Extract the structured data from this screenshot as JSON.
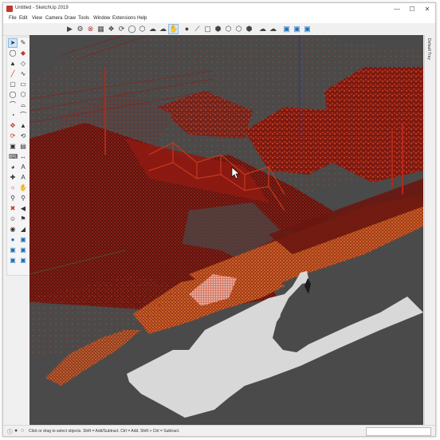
{
  "window": {
    "title": "Untitled - SketchUp 2019"
  },
  "window_controls": [
    {
      "name": "minimize-button",
      "glyph": "—"
    },
    {
      "name": "maximize-button",
      "glyph": "☐"
    },
    {
      "name": "close-button",
      "glyph": "✕"
    }
  ],
  "menu": [
    "File",
    "Edit",
    "View",
    "Camera",
    "Draw",
    "Tools",
    "Window",
    "Extensions",
    "Help"
  ],
  "toolbar": {
    "icons": [
      "select-icon",
      "gear-icon",
      "eraser-icon",
      "paint-icon",
      "components-icon",
      "orbit-icon",
      "circle-icon",
      "polygon-icon",
      "cloud-upload-icon",
      "cloud-download-icon",
      "pan-icon",
      "dot-icon",
      "line-icon",
      "box-icon",
      "cube-icon",
      "section-icon",
      "hexagon-icon",
      "cube-outline-icon",
      "cloud-icon",
      "cloud-sync-icon",
      "layers-icon",
      "layers-alt-icon"
    ],
    "selected_icon": "pan-icon"
  },
  "left_tools": [
    "select",
    "eraser",
    "paint",
    "tape",
    "line",
    "arc",
    "rectangle",
    "circle",
    "push-pull",
    "offset",
    "move",
    "rotate",
    "scale",
    "follow-me",
    "tape-measure",
    "protractor",
    "dimension",
    "text",
    "axes",
    "3d-text",
    "orbit",
    "pan",
    "zoom",
    "zoom-window",
    "zoom-extents",
    "previous",
    "position-camera",
    "walk",
    "look-around",
    "section-plane",
    "section-display",
    "section-fill",
    "style-xray",
    "style-back-edges",
    "style-wire",
    "style-hidden",
    "style-shaded",
    "style-textured"
  ],
  "tray": {
    "label": "Default Tray"
  },
  "status": {
    "icons": [
      "info-icon",
      "geo-icon",
      "credit-icon"
    ],
    "text": "Click or drag to select objects. Shift = Add/Subtract. Ctrl = Add. Shift + Ctrl = Subtract.",
    "measurements": ""
  },
  "colors": {
    "viewport_background": "#4a4a4a",
    "point_cloud_red": "#8e1a12",
    "point_cloud_orange": "#d0511e",
    "point_cloud_yellow": "#e8b04a",
    "road_surface": "#d8d8d8",
    "axis_blue": "#2a2aa8"
  }
}
